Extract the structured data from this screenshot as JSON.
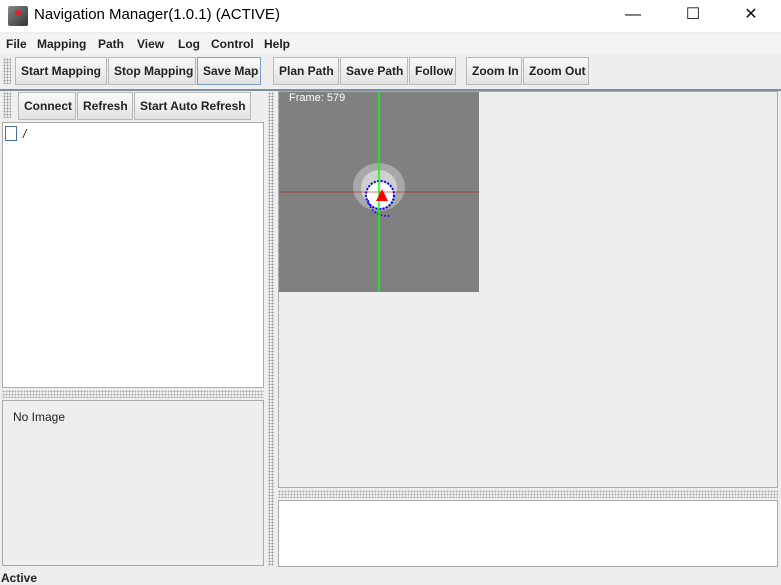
{
  "window": {
    "title": "Navigation Manager(1.0.1) (ACTIVE)",
    "minimize": "—",
    "maximize": "☐",
    "close": "✕"
  },
  "menu": [
    "File",
    "Mapping",
    "Path",
    "View",
    "Log",
    "Control",
    "Help"
  ],
  "toolbar": [
    "Start Mapping",
    "Stop Mapping",
    "Save Map",
    "Plan Path",
    "Save Path",
    "Follow",
    "Zoom In",
    "Zoom Out"
  ],
  "left_toolbar": [
    "Connect",
    "Refresh",
    "Start Auto Refresh"
  ],
  "tree": {
    "root": "/"
  },
  "image_panel": {
    "text": "No Image"
  },
  "map": {
    "frame_label": "Frame: 579",
    "colors": {
      "background": "#808080",
      "vertical_axis": "#00ff00",
      "horizontal_axis": "#cc0000",
      "robot": "#ff0000",
      "path": "#0000ff"
    }
  },
  "status": "Active"
}
